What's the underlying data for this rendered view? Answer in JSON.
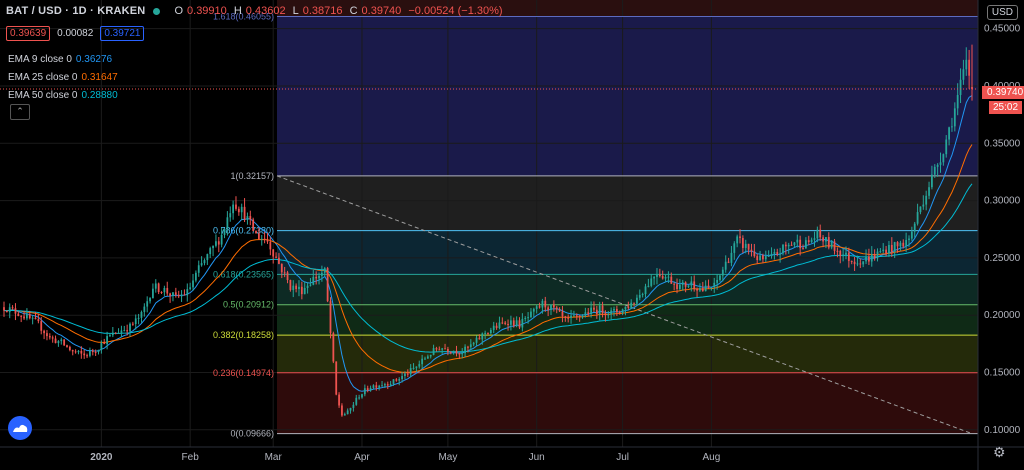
{
  "header": {
    "symbol": "BAT / USD · 1D · KRAKEN",
    "ohlc": [
      {
        "k": "O",
        "v": "0.39910"
      },
      {
        "k": "H",
        "v": "0.43602"
      },
      {
        "k": "L",
        "v": "0.38716"
      },
      {
        "k": "C",
        "v": "0.39740"
      }
    ],
    "change": "−0.00524 (−1.30%)"
  },
  "bid_ask": {
    "bid": "0.39639",
    "spread": "0.00082",
    "ask": "0.39721"
  },
  "indicators": [
    {
      "label": "EMA 9 close 0",
      "value": "0.36276",
      "color": "#2196f3"
    },
    {
      "label": "EMA 25 close 0",
      "value": "0.31647",
      "color": "#ff6d00"
    },
    {
      "label": "EMA 50 close 0",
      "value": "0.28880",
      "color": "#00bcd4"
    }
  ],
  "currency_button": "USD",
  "last_price": "0.39740",
  "countdown": "25:02",
  "x_axis_labels": [
    "2020",
    "Feb",
    "Mar",
    "Apr",
    "May",
    "Jun",
    "Jul",
    "Aug"
  ],
  "y_axis_labels": [
    "0.45000",
    "0.40000",
    "0.35000",
    "0.30000",
    "0.25000",
    "0.20000",
    "0.15000",
    "0.10000"
  ],
  "fib_labels": [
    {
      "label": "1.618(0.46055)",
      "color": "#5c6bc0"
    },
    {
      "label": "1(0.32157)",
      "color": "#b2b5be"
    },
    {
      "label": "0.786(0.27380)",
      "color": "#4fc3f7"
    },
    {
      "label": "0.618(0.23565)",
      "color": "#26a69a"
    },
    {
      "label": "0.5(0.20912)",
      "color": "#66bb6a"
    },
    {
      "label": "0.382(0.18258)",
      "color": "#cddc39"
    },
    {
      "label": "0.236(0.14974)",
      "color": "#ef5350"
    },
    {
      "label": "0(0.09666)",
      "color": "#b2b5be"
    }
  ],
  "chart_data": {
    "type": "candlestick",
    "symbol": "BAT / USD",
    "interval": "1D",
    "exchange": "KRAKEN",
    "ylim": [
      0.085,
      0.475
    ],
    "fibonacci": [
      {
        "level": 1.618,
        "price": 0.46055,
        "zone_color": "#1a1a4a"
      },
      {
        "level": 1,
        "price": 0.32157,
        "zone_color": "#1f1f1f"
      },
      {
        "level": 0.786,
        "price": 0.2738,
        "zone_color": "#0c2633"
      },
      {
        "level": 0.618,
        "price": 0.23565,
        "zone_color": "#0d2a24"
      },
      {
        "level": 0.5,
        "price": 0.20912,
        "zone_color": "#0f2a16"
      },
      {
        "level": 0.382,
        "price": 0.18258,
        "zone_color": "#242a0a"
      },
      {
        "level": 0.236,
        "price": 0.14974,
        "zone_color": "#2e0b0b"
      },
      {
        "level": 0,
        "price": 0.09666,
        "zone_color": "#2e0b0b"
      }
    ],
    "trend_path": [
      [
        0,
        0.207
      ],
      [
        4,
        0.203
      ],
      [
        8,
        0.198
      ],
      [
        12,
        0.192
      ],
      [
        16,
        0.18
      ],
      [
        20,
        0.176
      ],
      [
        24,
        0.168
      ],
      [
        28,
        0.165
      ],
      [
        32,
        0.17
      ],
      [
        36,
        0.18
      ],
      [
        40,
        0.186
      ],
      [
        44,
        0.19
      ],
      [
        48,
        0.2
      ],
      [
        52,
        0.225
      ],
      [
        56,
        0.222
      ],
      [
        60,
        0.215
      ],
      [
        64,
        0.22
      ],
      [
        68,
        0.24
      ],
      [
        72,
        0.255
      ],
      [
        76,
        0.27
      ],
      [
        80,
        0.3
      ],
      [
        84,
        0.288
      ],
      [
        88,
        0.27
      ],
      [
        92,
        0.265
      ],
      [
        96,
        0.245
      ],
      [
        100,
        0.225
      ],
      [
        104,
        0.222
      ],
      [
        108,
        0.232
      ],
      [
        112,
        0.238
      ],
      [
        116,
        0.13
      ],
      [
        118,
        0.113
      ],
      [
        120,
        0.115
      ],
      [
        124,
        0.13
      ],
      [
        128,
        0.138
      ],
      [
        132,
        0.14
      ],
      [
        136,
        0.142
      ],
      [
        140,
        0.148
      ],
      [
        144,
        0.155
      ],
      [
        148,
        0.165
      ],
      [
        152,
        0.172
      ],
      [
        156,
        0.17
      ],
      [
        160,
        0.168
      ],
      [
        164,
        0.175
      ],
      [
        168,
        0.185
      ],
      [
        172,
        0.19
      ],
      [
        176,
        0.195
      ],
      [
        180,
        0.192
      ],
      [
        184,
        0.2
      ],
      [
        188,
        0.21
      ],
      [
        192,
        0.205
      ],
      [
        196,
        0.195
      ],
      [
        200,
        0.198
      ],
      [
        204,
        0.203
      ],
      [
        208,
        0.205
      ],
      [
        212,
        0.202
      ],
      [
        216,
        0.205
      ],
      [
        220,
        0.212
      ],
      [
        224,
        0.225
      ],
      [
        228,
        0.238
      ],
      [
        232,
        0.232
      ],
      [
        236,
        0.225
      ],
      [
        240,
        0.228
      ],
      [
        244,
        0.222
      ],
      [
        248,
        0.225
      ],
      [
        252,
        0.245
      ],
      [
        256,
        0.265
      ],
      [
        260,
        0.258
      ],
      [
        264,
        0.248
      ],
      [
        268,
        0.25
      ],
      [
        272,
        0.258
      ],
      [
        276,
        0.264
      ],
      [
        280,
        0.262
      ],
      [
        284,
        0.27
      ],
      [
        288,
        0.262
      ],
      [
        292,
        0.255
      ],
      [
        296,
        0.248
      ],
      [
        300,
        0.248
      ],
      [
        304,
        0.252
      ],
      [
        308,
        0.258
      ],
      [
        312,
        0.26
      ],
      [
        316,
        0.266
      ],
      [
        320,
        0.295
      ],
      [
        324,
        0.32
      ],
      [
        328,
        0.345
      ],
      [
        332,
        0.38
      ],
      [
        336,
        0.42
      ],
      [
        338,
        0.398
      ]
    ]
  }
}
